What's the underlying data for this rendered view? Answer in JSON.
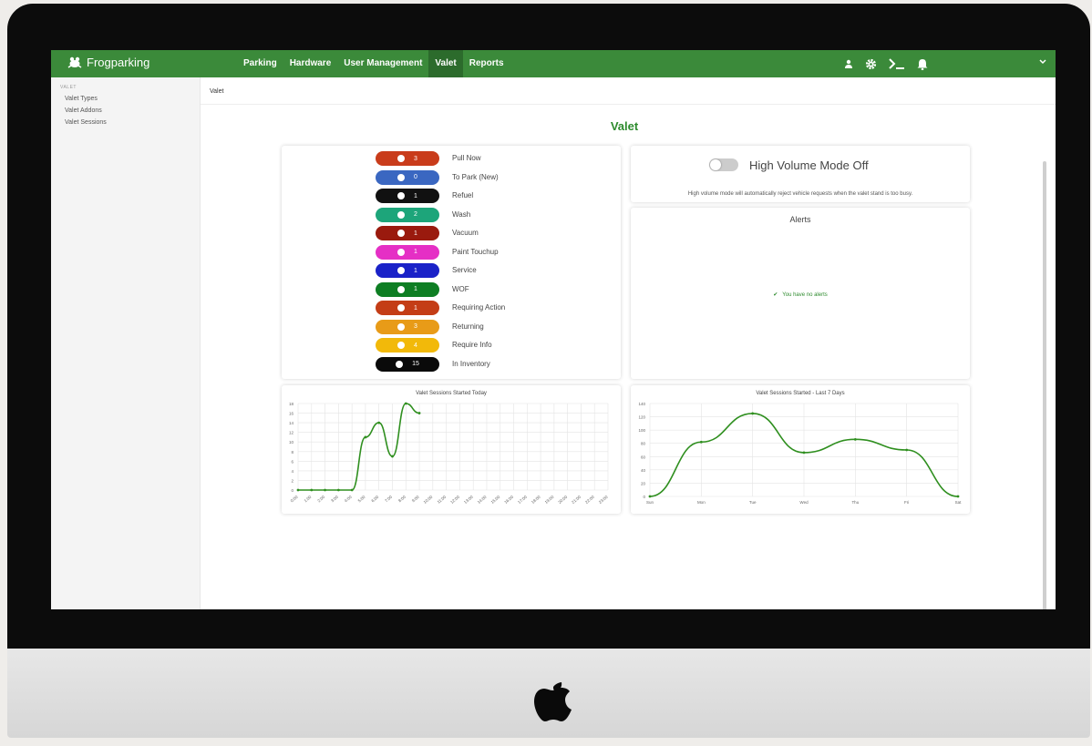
{
  "app": {
    "brand": "Frogparking"
  },
  "nav": {
    "links": [
      "Parking",
      "Hardware",
      "User Management",
      "Valet",
      "Reports"
    ],
    "active": "Valet",
    "icons": [
      "user-icon",
      "gear-icon",
      "terminal-icon",
      "bell-icon",
      "chevron-down-icon"
    ]
  },
  "sidebar": {
    "section": "VALET",
    "items": [
      "Valet Types",
      "Valet Addons",
      "Valet Sessions"
    ]
  },
  "breadcrumb": "Valet",
  "page_title": "Valet",
  "statuses": [
    {
      "label": "Pull Now",
      "count": "3",
      "color": "#c93c1b",
      "icon": "plus-circle-icon"
    },
    {
      "label": "To Park (New)",
      "count": "0",
      "color": "#3a67c1",
      "icon": "parking-icon"
    },
    {
      "label": "Refuel",
      "count": "1",
      "color": "#111111",
      "icon": "fuel-pump-icon"
    },
    {
      "label": "Wash",
      "count": "2",
      "color": "#1da57a",
      "icon": "car-wash-icon"
    },
    {
      "label": "Vacuum",
      "count": "1",
      "color": "#9a1a0e",
      "icon": "vacuum-icon"
    },
    {
      "label": "Paint Touchup",
      "count": "1",
      "color": "#e52fc5",
      "icon": "paint-icon"
    },
    {
      "label": "Service",
      "count": "1",
      "color": "#1a22c8",
      "icon": "car-icon"
    },
    {
      "label": "WOF",
      "count": "1",
      "color": "#0e7e23",
      "icon": "check-circle-icon"
    },
    {
      "label": "Requiring Action",
      "count": "1",
      "color": "#c43d16",
      "icon": "alert-circle-icon"
    },
    {
      "label": "Returning",
      "count": "3",
      "color": "#e89b18",
      "icon": "return-icon"
    },
    {
      "label": "Require Info",
      "count": "4",
      "color": "#f2b90a",
      "icon": "question-circle-icon"
    },
    {
      "label": "In Inventory",
      "count": "15",
      "color": "#0a0a0a",
      "icon": "list-icon"
    }
  ],
  "high_volume": {
    "title": "High Volume Mode Off",
    "enabled": false,
    "description": "High volume mode will automatically reject vehicle requests when the valet stand is too busy."
  },
  "alerts": {
    "title": "Alerts",
    "empty_text": "You have no alerts"
  },
  "chart_data": [
    {
      "type": "line",
      "title": "Valet Sessions Started Today",
      "categories": [
        "0:00",
        "1:00",
        "2:00",
        "3:00",
        "4:00",
        "5:00",
        "6:00",
        "7:00",
        "8:00",
        "9:00",
        "10:00",
        "11:00",
        "12:00",
        "13:00",
        "14:00",
        "15:00",
        "16:00",
        "17:00",
        "18:00",
        "19:00",
        "20:00",
        "21:00",
        "22:00",
        "23:00"
      ],
      "values": [
        0,
        0,
        0,
        0,
        0,
        11,
        14,
        7,
        18,
        16
      ],
      "ylim": [
        0,
        18
      ],
      "yticks": [
        0,
        2,
        4,
        6,
        8,
        10,
        12,
        14,
        16,
        18
      ],
      "grid": true,
      "color": "#2f8f1f"
    },
    {
      "type": "line",
      "title": "Valet Sessions Started - Last 7 Days",
      "categories": [
        "Sun",
        "Mon",
        "Tue",
        "Wed",
        "Thu",
        "Fri",
        "Sat"
      ],
      "values": [
        0,
        82,
        125,
        66,
        86,
        70,
        0
      ],
      "ylim": [
        0,
        140
      ],
      "yticks": [
        0,
        20,
        40,
        60,
        80,
        100,
        120,
        140
      ],
      "grid": true,
      "color": "#2f8f1f"
    }
  ]
}
